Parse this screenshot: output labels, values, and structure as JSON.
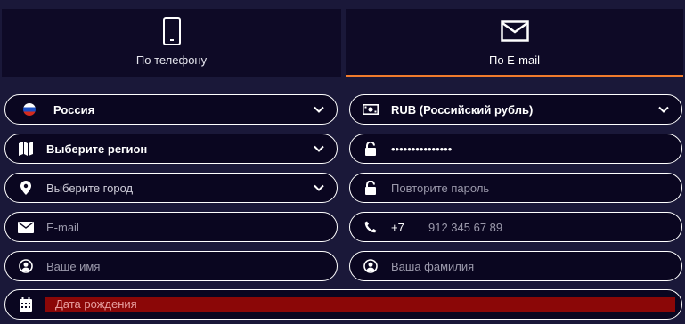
{
  "tabs": [
    {
      "label": "По телефону",
      "icon": "smartphone-icon"
    },
    {
      "label": "По E-mail",
      "icon": "envelope-icon",
      "active": true
    }
  ],
  "accent_color": "#f07b2c",
  "error_color": "#8b0707",
  "form": {
    "country": {
      "value": "Россия",
      "icon": "russia-flag-icon"
    },
    "currency": {
      "value": "RUB (Российский рубль)",
      "icon": "banknote-icon"
    },
    "region": {
      "placeholder": "Выберите регион",
      "icon": "map-icon"
    },
    "password": {
      "value": "•••••••••••••••",
      "icon": "lock-icon"
    },
    "city": {
      "placeholder": "Выберите город",
      "icon": "location-pin-icon"
    },
    "password_repeat": {
      "placeholder": "Повторите пароль",
      "icon": "lock-icon"
    },
    "email": {
      "placeholder": "E-mail",
      "icon": "envelope-icon"
    },
    "phone": {
      "prefix": "+7",
      "placeholder": "912 345 67 89",
      "icon": "phone-handset-icon"
    },
    "first_name": {
      "placeholder": "Ваше имя",
      "icon": "user-icon"
    },
    "last_name": {
      "placeholder": "Ваша фамилия",
      "icon": "user-icon"
    },
    "birth_date": {
      "placeholder": "Дата рождения",
      "icon": "calendar-icon"
    }
  }
}
